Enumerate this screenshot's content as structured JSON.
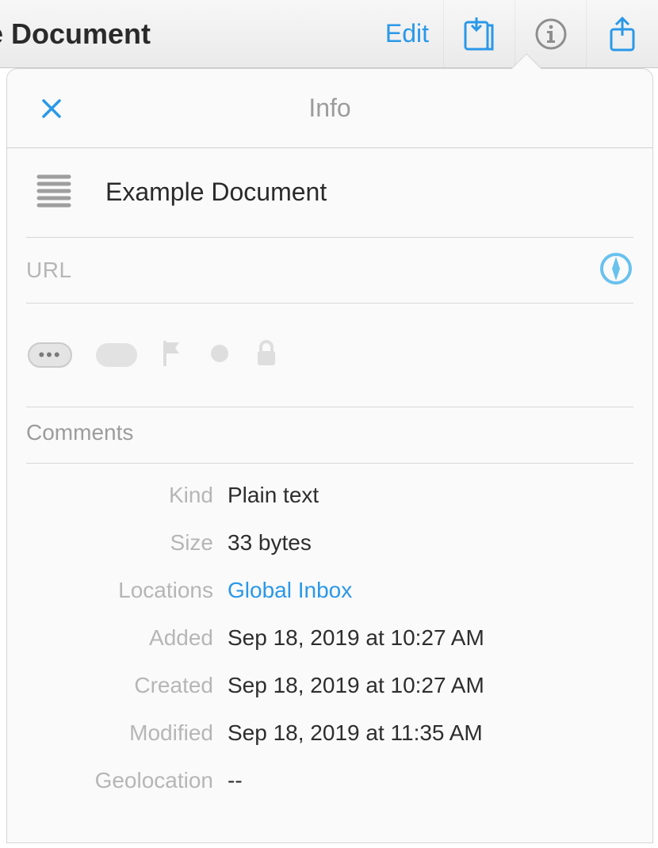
{
  "toolbar": {
    "title": "ole Document",
    "edit_label": "Edit"
  },
  "popover": {
    "title": "Info",
    "document_name": "Example Document",
    "url_label": "URL",
    "comments_label": "Comments",
    "meta": {
      "kind": {
        "label": "Kind",
        "value": "Plain text"
      },
      "size": {
        "label": "Size",
        "value": "33 bytes"
      },
      "locations": {
        "label": "Locations",
        "value": "Global Inbox"
      },
      "added": {
        "label": "Added",
        "value": "Sep 18, 2019 at 10:27 AM"
      },
      "created": {
        "label": "Created",
        "value": "Sep 18, 2019 at 10:27 AM"
      },
      "modified": {
        "label": "Modified",
        "value": "Sep 18, 2019 at 11:35 AM"
      },
      "geolocation": {
        "label": "Geolocation",
        "value": "--"
      }
    },
    "tag_pill": "•••"
  },
  "accent": "#2a98e8"
}
